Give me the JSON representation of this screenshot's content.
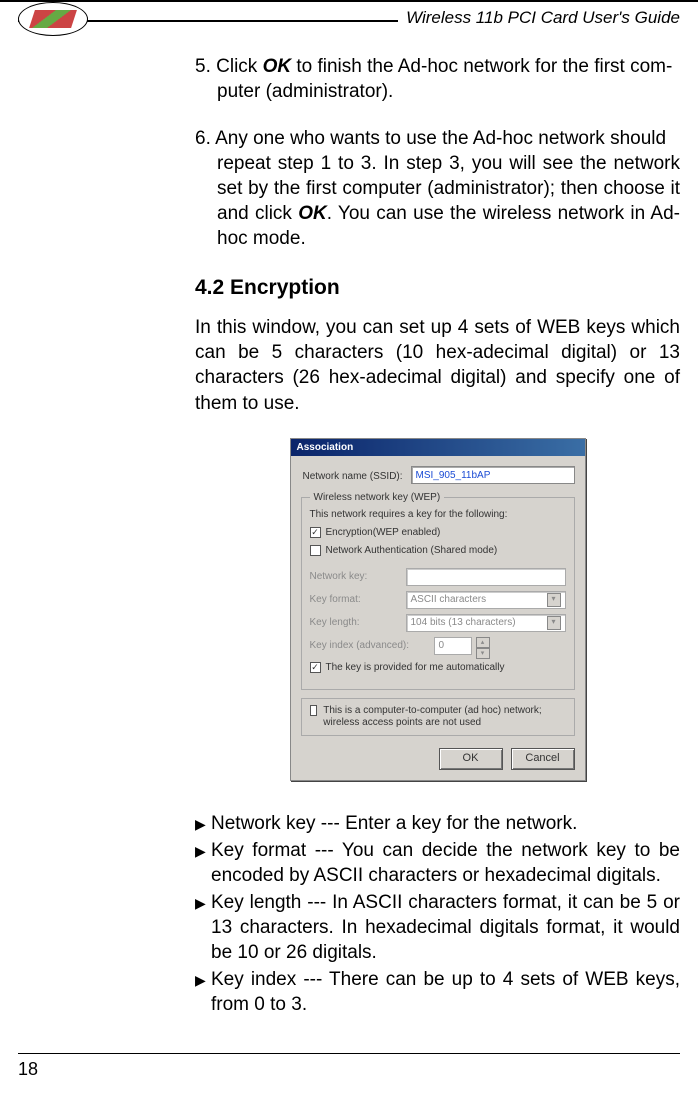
{
  "header": {
    "title": "Wireless 11b PCI Card User's Guide"
  },
  "steps": {
    "s5_prefix": "5. Click ",
    "s5_ok": "OK",
    "s5_rest": " to finish the Ad-hoc network for the first com",
    "s5_line2": "puter (administrator).",
    "s6_part1": "6. Any one who wants to use the Ad-hoc network should",
    "s6_part2": "repeat step 1 to 3. In step 3, you will see the network set by the first computer (administrator); then choose it and click ",
    "s6_ok": "OK",
    "s6_part3": ". You can use the wireless network in Ad-hoc mode."
  },
  "section": {
    "title": "4.2 Encryption",
    "intro": "In this window, you can set up 4 sets of WEB keys which can be 5 characters (10 hex-adecimal digital) or 13 characters (26 hex-adecimal digital) and specify one of them to use."
  },
  "dialog": {
    "title": "Association",
    "ssid_label": "Network name (SSID):",
    "ssid_value": "MSI_905_11bAP",
    "fieldset_legend": "Wireless network key (WEP)",
    "requires": "This network requires a key for the following:",
    "opt_enc": "Encryption(WEP enabled)",
    "opt_auth": "Network Authentication (Shared mode)",
    "netkey": "Network key:",
    "keyformat": "Key format:",
    "keyformat_val": "ASCII characters",
    "keylength": "Key length:",
    "keylength_val": "104 bits (13 characters)",
    "keyindex": "Key index (advanced):",
    "keyindex_val": "0",
    "auto": "The key is provided for me automatically",
    "adhoc": "This is a computer-to-computer (ad hoc) network; wireless access points are not used",
    "ok": "OK",
    "cancel": "Cancel"
  },
  "bullets": {
    "b1": "Network key --- Enter a key for the network.",
    "b2": "Key format --- You can decide the network key to be encoded by ASCII characters or hexadecimal digitals.",
    "b3": "Key length --- In ASCII characters format, it can be 5 or 13 characters. In hexadecimal digitals format, it would be 10 or 26 digitals.",
    "b4": "Key index --- There can be up to 4 sets of WEB keys, from 0 to 3."
  },
  "page": "18"
}
